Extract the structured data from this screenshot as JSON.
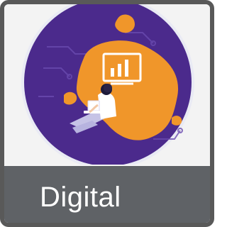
{
  "tile": {
    "label": "Digital",
    "illustration": "person-with-laptop-and-analytics-screen-icon"
  },
  "colors": {
    "frame": "#595959",
    "circle": "#4b2a8c",
    "accent": "#f0962a",
    "label_bar": "#5f6266",
    "label_text": "#ffffff"
  }
}
